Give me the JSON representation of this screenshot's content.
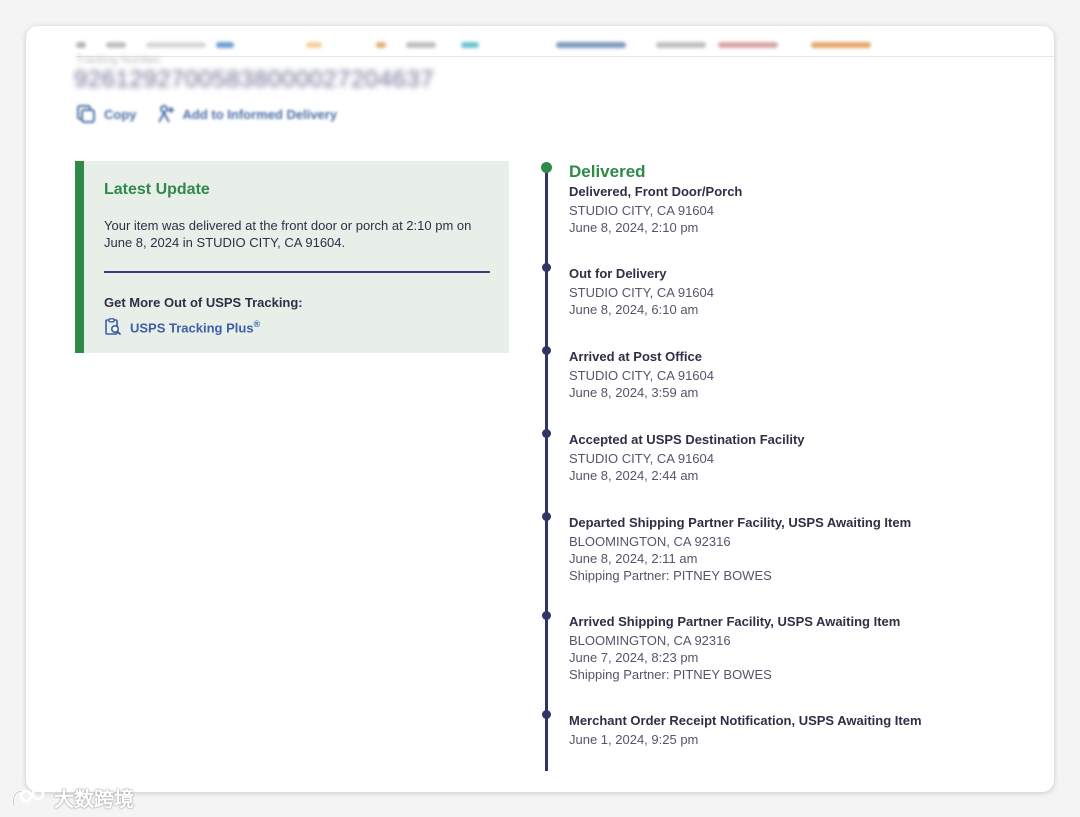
{
  "header": {
    "tracking_label": "Tracking Number:",
    "tracking_number": "9261292700583800002720463​7",
    "copy_label": "Copy",
    "informed_delivery_label": "Add to Informed Delivery"
  },
  "latest_update": {
    "title": "Latest Update",
    "summary": "Your item was delivered at the front door or porch at 2:10 pm on June 8, 2024 in STUDIO CITY, CA 91604.",
    "more_label": "Get More Out of USPS Tracking:",
    "plus_label": "USPS Tracking Plus",
    "plus_mark": "®"
  },
  "timeline": [
    {
      "status": "Delivered",
      "detail": "Delivered, Front Door/Porch",
      "location": "STUDIO CITY, CA 91604",
      "datetime": "June 8, 2024, 2:10 pm"
    },
    {
      "status": "Out for Delivery",
      "location": "STUDIO CITY, CA 91604",
      "datetime": "June 8, 2024, 6:10 am"
    },
    {
      "status": "Arrived at Post Office",
      "location": "STUDIO CITY, CA 91604",
      "datetime": "June 8, 2024, 3:59 am"
    },
    {
      "status": "Accepted at USPS Destination Facility",
      "location": "STUDIO CITY, CA 91604",
      "datetime": "June 8, 2024, 2:44 am"
    },
    {
      "status": "Departed Shipping Partner Facility, USPS Awaiting Item",
      "location": "BLOOMINGTON, CA 92316",
      "datetime": "June 8, 2024, 2:11 am",
      "partner": "Shipping Partner: PITNEY BOWES"
    },
    {
      "status": "Arrived Shipping Partner Facility, USPS Awaiting Item",
      "location": "BLOOMINGTON, CA 92316",
      "datetime": "June 7, 2024, 8:23 pm",
      "partner": "Shipping Partner: PITNEY BOWES"
    },
    {
      "status": "Merchant Order Receipt Notification, USPS Awaiting Item",
      "datetime": "June 1, 2024, 9:25 pm"
    }
  ],
  "watermark": {
    "text": "大数跨境"
  },
  "colors": {
    "accent_green": "#2f8a4a",
    "navy": "#333366",
    "link_blue": "#3d5ea8",
    "panel_bg": "#e8eee8"
  }
}
